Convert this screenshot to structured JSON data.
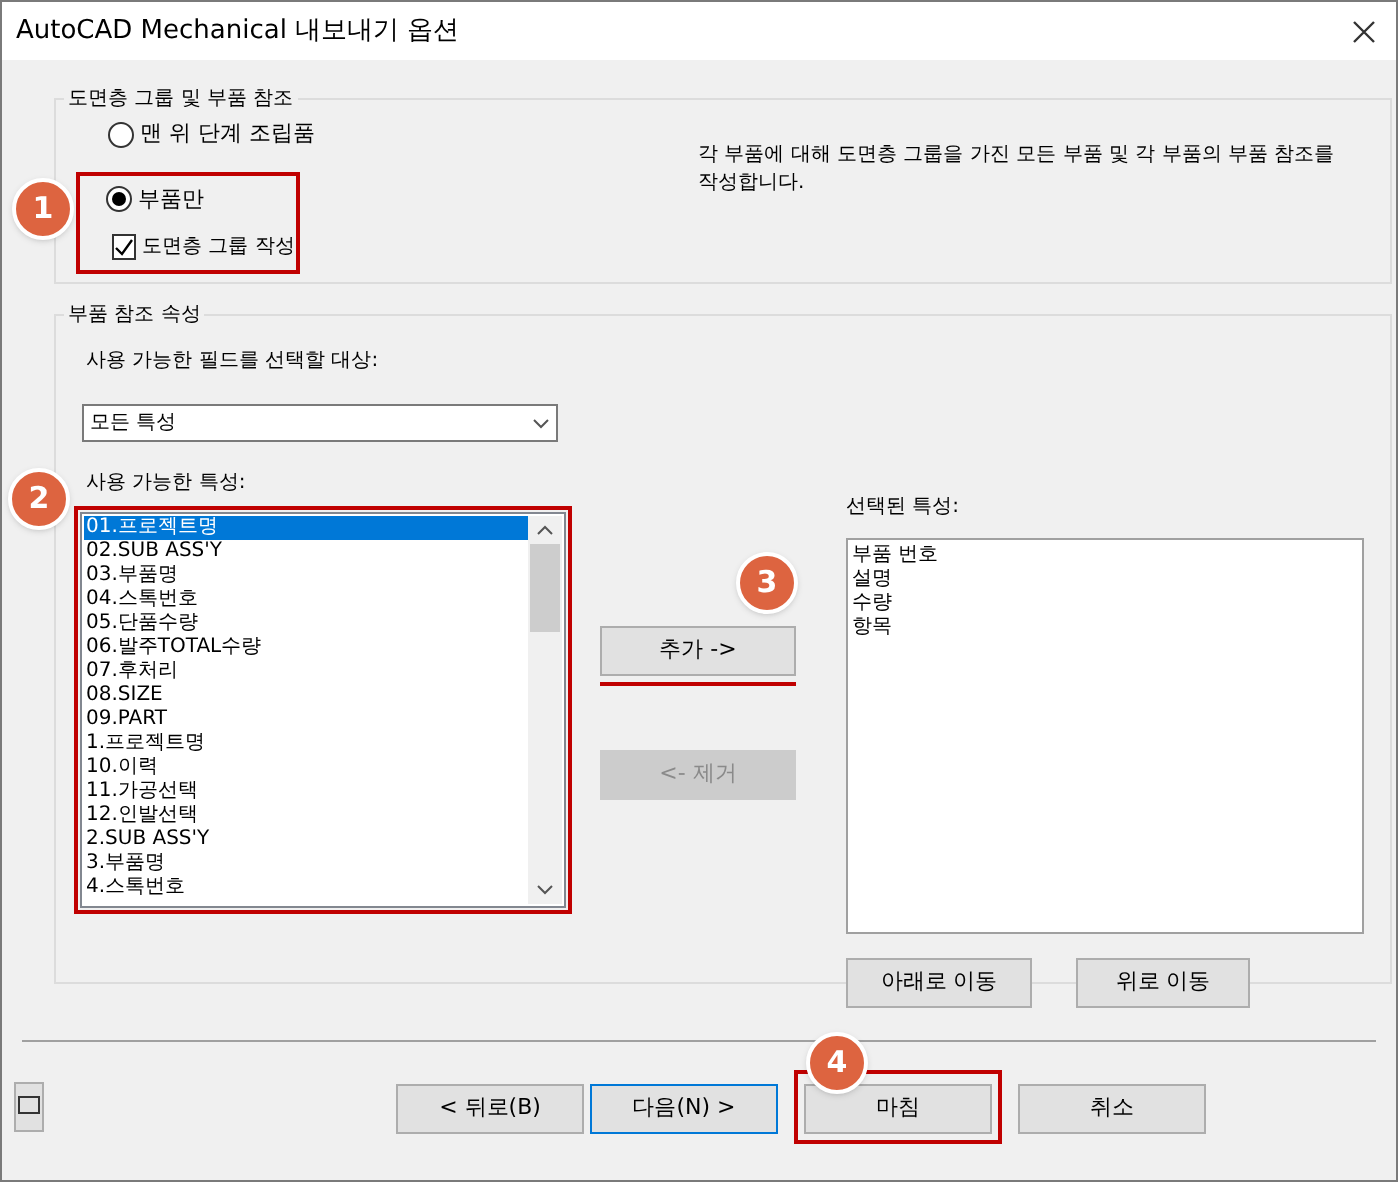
{
  "window": {
    "title": "AutoCAD Mechanical 내보내기 옵션"
  },
  "group_layers": {
    "title": "도면층 그룹 및 부품 참조",
    "radios": [
      {
        "label": "맨 위 단계 조립품",
        "selected": false
      },
      {
        "label": "부품만",
        "selected": true
      }
    ],
    "checkbox": {
      "label": "도면층 그룹 작성",
      "checked": true
    },
    "description": "각 부품에 대해 도면층 그룹을 가진 모든 부품 및 각 부품의 부품 참조를 작성합니다."
  },
  "group_props": {
    "title": "부품 참조 속성",
    "filter_label": "사용 가능한 필드를 선택할 대상:",
    "filter_value": "모든 특성",
    "available_label": "사용 가능한 특성:",
    "available": [
      {
        "label": "01.프로젝트명",
        "selected": true
      },
      {
        "label": "02.SUB ASS'Y",
        "selected": false
      },
      {
        "label": "03.부품명",
        "selected": false
      },
      {
        "label": "04.스톡번호",
        "selected": false
      },
      {
        "label": "05.단품수량",
        "selected": false
      },
      {
        "label": "06.발주TOTAL수량",
        "selected": false
      },
      {
        "label": "07.후처리",
        "selected": false
      },
      {
        "label": "08.SIZE",
        "selected": false
      },
      {
        "label": "09.PART",
        "selected": false
      },
      {
        "label": "1.프로젝트명",
        "selected": false
      },
      {
        "label": "10.이력",
        "selected": false
      },
      {
        "label": "11.가공선택",
        "selected": false
      },
      {
        "label": "12.인발선택",
        "selected": false
      },
      {
        "label": "2.SUB ASS'Y",
        "selected": false
      },
      {
        "label": "3.부품명",
        "selected": false
      },
      {
        "label": "4.스톡번호",
        "selected": false
      }
    ],
    "add_button": {
      "label": "추가 ->",
      "disabled": false
    },
    "remove_button": {
      "label": "<- 제거",
      "disabled": true
    },
    "selected_label": "선택된 특성:",
    "selected": [
      "부품 번호",
      "설명",
      "수량",
      "항목"
    ],
    "move_buttons": [
      "아래로 이동",
      "위로 이동"
    ]
  },
  "footer_buttons": [
    {
      "label": "< 뒤로(B)",
      "focused": false
    },
    {
      "label": "다음(N) >",
      "focused": true
    },
    {
      "label": "마침",
      "focused": false
    },
    {
      "label": "취소",
      "focused": false
    }
  ],
  "annotations": [
    "1",
    "2",
    "3",
    "4"
  ]
}
